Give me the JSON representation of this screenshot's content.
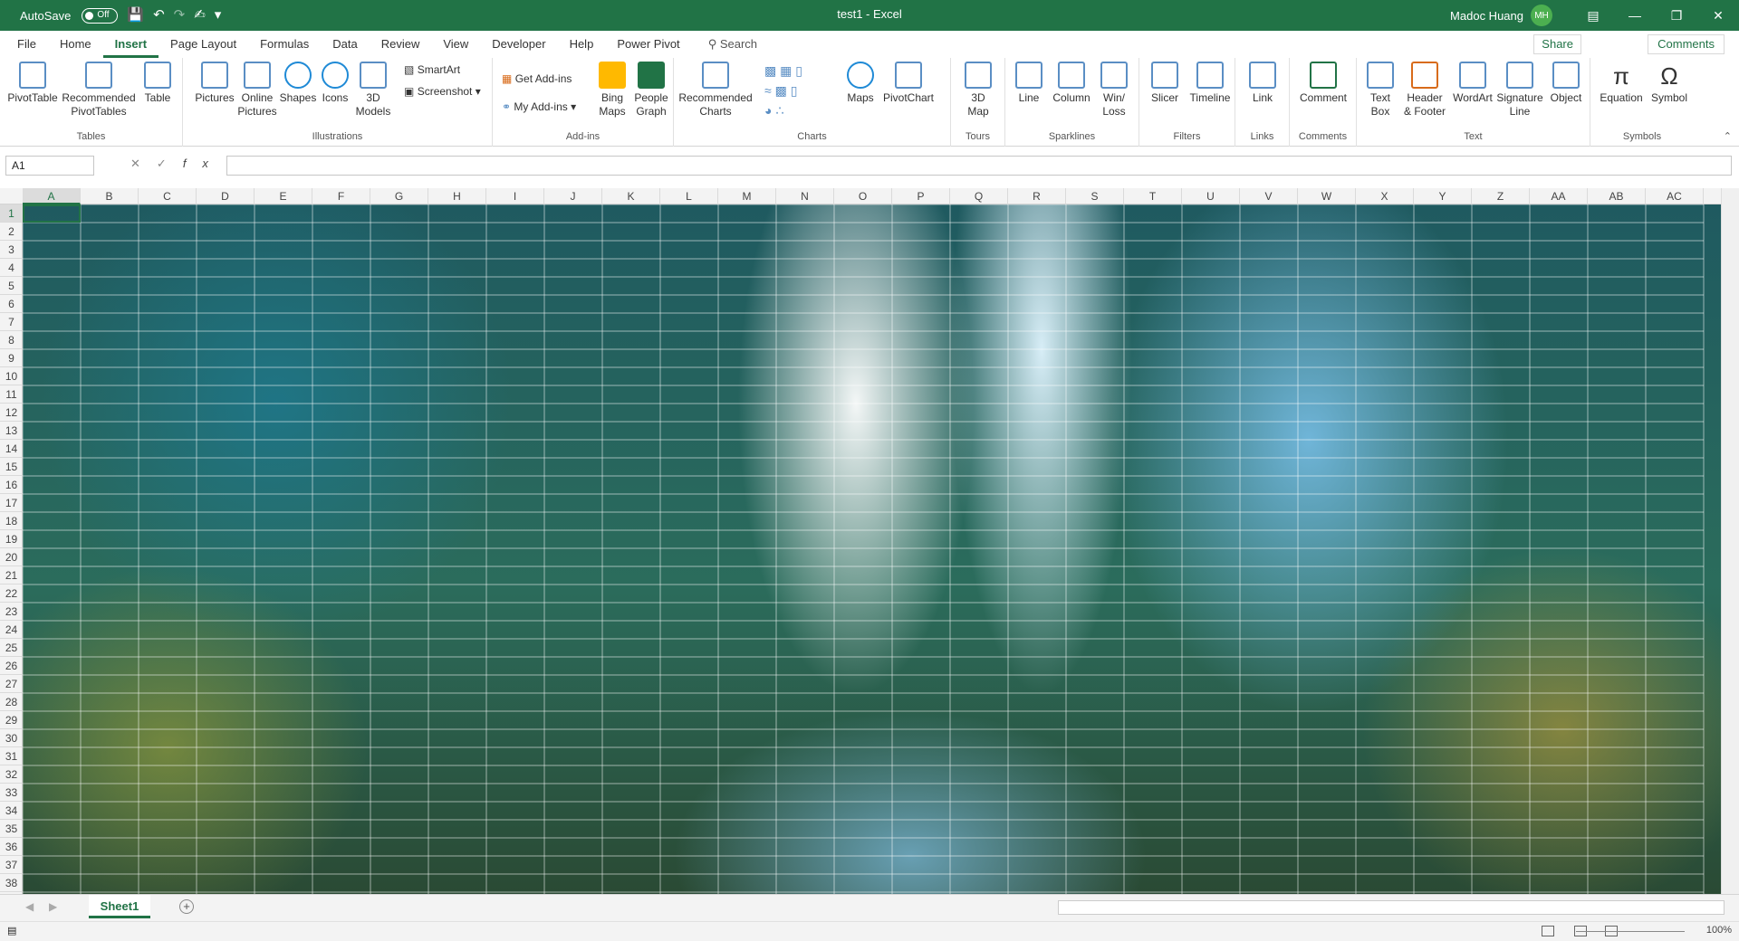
{
  "titlebar": {
    "autosave": "AutoSave",
    "autosave_state": "Off",
    "document": "test1 - Excel",
    "user": "Madoc Huang",
    "initials": "MH"
  },
  "menu": {
    "tabs": [
      "File",
      "Home",
      "Insert",
      "Page Layout",
      "Formulas",
      "Data",
      "Review",
      "View",
      "Developer",
      "Help",
      "Power Pivot"
    ],
    "active": "Insert",
    "search": "Search",
    "share": "Share",
    "comments": "Comments"
  },
  "ribbon": {
    "tables": {
      "label": "Tables",
      "pivottable": "PivotTable",
      "rec_pivot_1": "Recommended",
      "rec_pivot_2": "PivotTables",
      "table": "Table"
    },
    "illustrations": {
      "label": "Illustrations",
      "pictures": "Pictures",
      "online_1": "Online",
      "online_2": "Pictures",
      "shapes": "Shapes",
      "icons": "Icons",
      "models_1": "3D",
      "models_2": "Models",
      "smartart": "SmartArt",
      "screenshot": "Screenshot"
    },
    "addins": {
      "label": "Add-ins",
      "get": "Get Add-ins",
      "my": "My Add-ins",
      "bing_1": "Bing",
      "bing_2": "Maps",
      "people_1": "People",
      "people_2": "Graph"
    },
    "charts": {
      "label": "Charts",
      "rec_1": "Recommended",
      "rec_2": "Charts",
      "maps": "Maps",
      "pivotchart": "PivotChart"
    },
    "tours": {
      "label": "Tours",
      "map_1": "3D",
      "map_2": "Map"
    },
    "sparklines": {
      "label": "Sparklines",
      "line": "Line",
      "column": "Column",
      "winloss_1": "Win/",
      "winloss_2": "Loss"
    },
    "filters": {
      "label": "Filters",
      "slicer": "Slicer",
      "timeline": "Timeline"
    },
    "links": {
      "label": "Links",
      "link": "Link"
    },
    "comments": {
      "label": "Comments",
      "comment": "Comment"
    },
    "text": {
      "label": "Text",
      "textbox_1": "Text",
      "textbox_2": "Box",
      "header_1": "Header",
      "header_2": "& Footer",
      "wordart": "WordArt",
      "sig_1": "Signature",
      "sig_2": "Line",
      "object": "Object"
    },
    "symbols": {
      "label": "Symbols",
      "equation": "Equation",
      "symbol": "Symbol"
    }
  },
  "formula": {
    "namebox": "A1",
    "fx": "fx",
    "value": ""
  },
  "sheet": {
    "columns": [
      "A",
      "B",
      "C",
      "D",
      "E",
      "F",
      "G",
      "H",
      "I",
      "J",
      "K",
      "L",
      "M",
      "N",
      "O",
      "P",
      "Q",
      "R",
      "S",
      "T",
      "U",
      "V",
      "W",
      "X",
      "Y",
      "Z",
      "AA",
      "AB",
      "AC"
    ],
    "rows": [
      "1",
      "2",
      "3",
      "4",
      "5",
      "6",
      "7",
      "8",
      "9",
      "10",
      "11",
      "12",
      "13",
      "14",
      "15",
      "16",
      "17",
      "18",
      "19",
      "20",
      "21",
      "22",
      "23",
      "24",
      "25",
      "26",
      "27",
      "28",
      "29",
      "30",
      "31",
      "32",
      "33",
      "34",
      "35",
      "36",
      "37",
      "38"
    ],
    "selected": "A1"
  },
  "tabs": {
    "sheet": "Sheet1"
  },
  "status": {
    "zoom": "100%"
  }
}
